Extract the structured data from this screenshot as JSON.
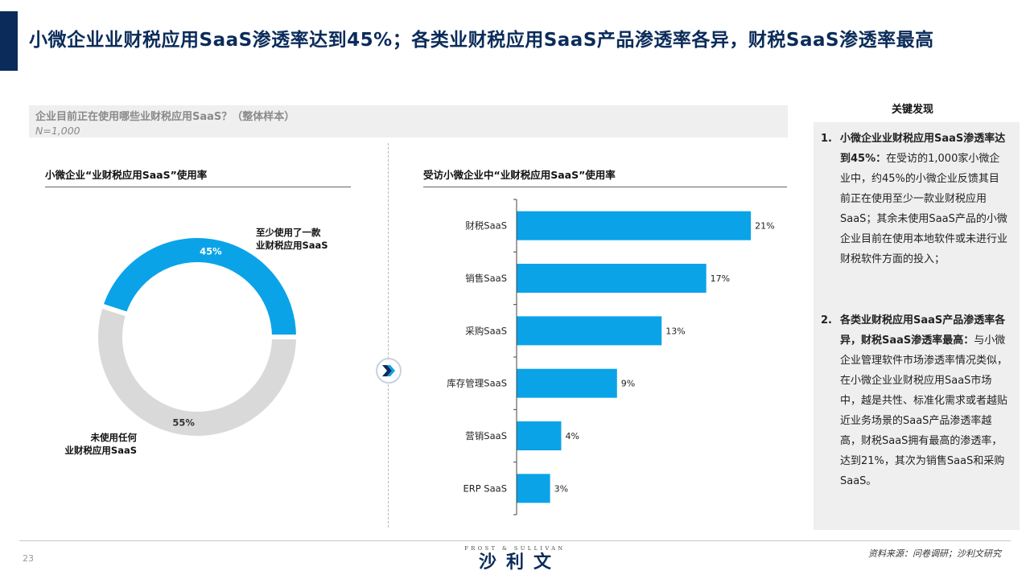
{
  "title": "小微企业业财税应用SaaS渗透率达到45%；各类业财税应用SaaS产品渗透率各异，财税SaaS渗透率最高",
  "question": {
    "text": "企业目前正在使用哪些业财税应用SaaS？（整体样本）",
    "sample": "N=1,000"
  },
  "left_section": {
    "title": "小微企业“业财税应用SaaS”使用率"
  },
  "right_section": {
    "title": "受访小微企业中“业财税应用SaaS”使用率"
  },
  "colors": {
    "accent": "#0b2c5a",
    "blue": "#0aa3e8",
    "gray": "#d9d9d9"
  },
  "chart_data": [
    {
      "type": "pie",
      "title": "小微企业“业财税应用SaaS”使用率",
      "slices": [
        {
          "label": "至少使用了一款业财税应用SaaS",
          "label_lines": [
            "至少使用了一款",
            "业财税应用SaaS"
          ],
          "value": 45,
          "display": "45%",
          "color": "#0aa3e8"
        },
        {
          "label": "未使用任何业财税应用SaaS",
          "label_lines": [
            "未使用任何",
            "业财税应用SaaS"
          ],
          "value": 55,
          "display": "55%",
          "color": "#d9d9d9"
        }
      ]
    },
    {
      "type": "bar",
      "orientation": "horizontal",
      "title": "受访小微企业中“业财税应用SaaS”使用率",
      "categories": [
        "财税SaaS",
        "销售SaaS",
        "采购SaaS",
        "库存管理SaaS",
        "营销SaaS",
        "ERP SaaS"
      ],
      "values": [
        21,
        17,
        13,
        9,
        4,
        3
      ],
      "value_labels": [
        "21%",
        "17%",
        "13%",
        "9%",
        "4%",
        "3%"
      ],
      "color": "#0aa3e8",
      "xlim": [
        0,
        22
      ]
    }
  ],
  "findings": {
    "title": "关键发现",
    "items": [
      {
        "num": "1.",
        "bold": "小微企业业财税应用SaaS渗透率达到45%：",
        "text": "在受访的1,000家小微企业中，约45%的小微企业反馈其目前正在使用至少一款业财税应用SaaS；其余未使用SaaS产品的小微企业目前在使用本地软件或未进行业财税软件方面的投入；"
      },
      {
        "num": "2.",
        "bold": "各类业财税应用SaaS产品渗透率各异，财税SaaS渗透率最高：",
        "text": "与小微企业管理软件市场渗透率情况类似，在小微企业业财税应用SaaS市场中，越是共性、标准化需求或者越贴近业务场景的SaaS产品渗透率越高，财税SaaS拥有最高的渗透率，达到21%，其次为销售SaaS和采购SaaS。"
      }
    ]
  },
  "footer": {
    "page": "23",
    "logo_top": "FROST & SULLIVAN",
    "logo_main": "沙利文",
    "source": "资料来源：问卷调研；沙利文研究"
  }
}
